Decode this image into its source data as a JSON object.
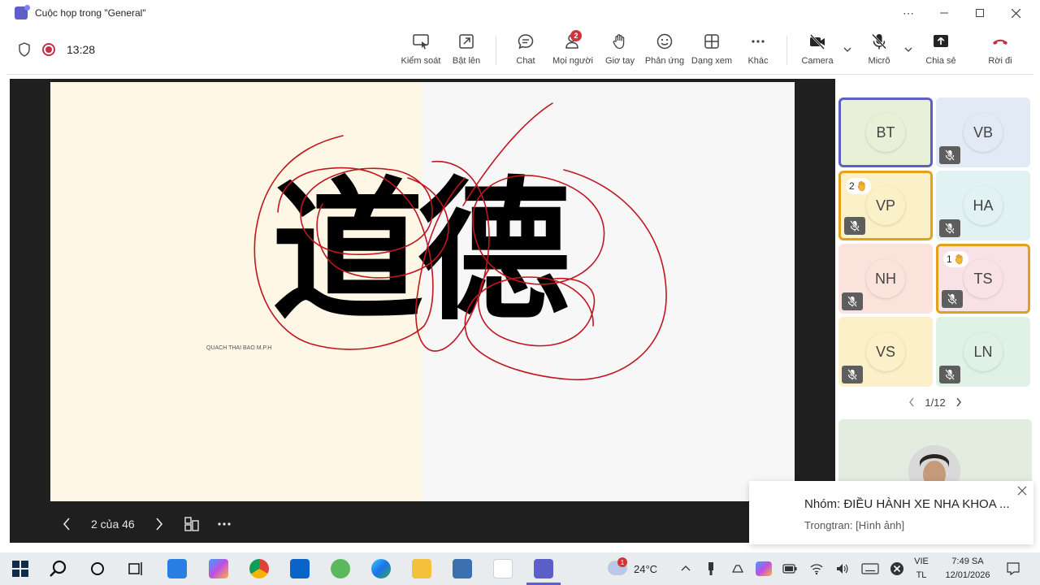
{
  "window": {
    "title": "Cuộc họp trong \"General\""
  },
  "meeting": {
    "timer": "13:28",
    "toolbar": {
      "control": "Kiểm soát",
      "popout": "Bật lên",
      "chat": "Chat",
      "people": "Mọi người",
      "people_badge": "2",
      "raise_hand": "Giơ tay",
      "react": "Phản ứng",
      "view": "Dạng xem",
      "more": "Khác",
      "camera": "Camera",
      "mic": "Micrô",
      "share": "Chia sẻ",
      "leave": "Rời đi"
    }
  },
  "slide": {
    "main_text": "道德",
    "credit": "QUACH THAI BAO M.P.H",
    "counter": "2 của 46"
  },
  "participants": [
    {
      "initials": "BT",
      "muted": false,
      "hand": "",
      "active": true,
      "color": "#e8f0d8"
    },
    {
      "initials": "VB",
      "muted": true,
      "hand": "",
      "active": false,
      "color": "#e2ebf5"
    },
    {
      "initials": "VP",
      "muted": true,
      "hand": "2",
      "active": false,
      "color": "#fbf1c8"
    },
    {
      "initials": "HA",
      "muted": true,
      "hand": "",
      "active": false,
      "color": "#e2f2f2"
    },
    {
      "initials": "NH",
      "muted": true,
      "hand": "",
      "active": false,
      "color": "#fbe3dc"
    },
    {
      "initials": "TS",
      "muted": true,
      "hand": "1",
      "active": false,
      "color": "#f9e2e6"
    },
    {
      "initials": "VS",
      "muted": true,
      "hand": "",
      "active": false,
      "color": "#fbf0c8"
    },
    {
      "initials": "LN",
      "muted": true,
      "hand": "",
      "active": false,
      "color": "#e0f2e6"
    }
  ],
  "pager": {
    "label": "1/12"
  },
  "toast": {
    "title": "Nhóm: ĐIỀU HÀNH XE NHA KHOA ...",
    "sender": "Trongtran:",
    "message": "[Hình ảnh]"
  },
  "taskbar": {
    "weather": "24°C",
    "weather_badge": "1",
    "lang_top": "VIE",
    "lang_bottom": "TL",
    "time": "7:49 SA",
    "date": "12/01/2026"
  }
}
